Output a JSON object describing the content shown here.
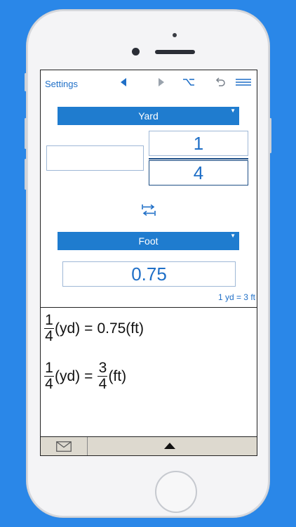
{
  "toolbar": {
    "settings_label": "Settings",
    "icons": [
      "back-triangle-icon",
      "forward-triangle-icon",
      "option-key-icon",
      "undo-icon",
      "menu-icon"
    ]
  },
  "from_unit": {
    "label": "Yard"
  },
  "fraction_input": {
    "whole": "",
    "numerator": "1",
    "denominator": "4"
  },
  "to_unit": {
    "label": "Foot"
  },
  "result": {
    "value": "0.75"
  },
  "conversion_note": "1 yd = 3 ft",
  "equations": {
    "decimal": {
      "num": "1",
      "den": "4",
      "lhs_unit": "(yd)",
      "eq": "=",
      "rhs": "0.75(ft)"
    },
    "fraction": {
      "num": "1",
      "den": "4",
      "lhs_unit": "(yd)",
      "eq": "=",
      "rhs_num": "3",
      "rhs_den": "4",
      "rhs_unit": "(ft)"
    }
  },
  "colors": {
    "background": "#2a87e8",
    "accent": "#1f7ccf",
    "text_blue": "#1f6fc7"
  }
}
